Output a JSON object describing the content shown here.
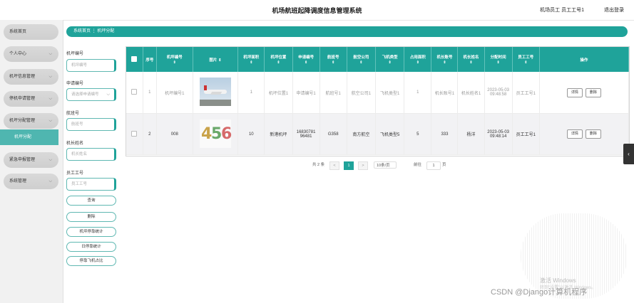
{
  "header": {
    "title": "机场航班起降调度信息管理系统",
    "user": "机场员工 员工工号1",
    "logout": "退出登录"
  },
  "sidebar": {
    "items": [
      {
        "label": "系统首页",
        "chevron": false
      },
      {
        "label": "个人中心",
        "chevron": true
      },
      {
        "label": "机坪信息管理",
        "chevron": true
      },
      {
        "label": "停机申请管理",
        "chevron": true
      },
      {
        "label": "机坪分配管理",
        "chevron": true
      },
      {
        "label": "紧急申报管理",
        "chevron": true
      },
      {
        "label": "系统管理",
        "chevron": true
      }
    ],
    "active_sub": "机坪分配"
  },
  "breadcrumb": {
    "home": "系统首页",
    "sep": "⋮",
    "current": "机坪分配"
  },
  "filters": {
    "apron_no_label": "机坪编号",
    "apron_no_placeholder": "机坪编号",
    "apply_no_label": "申请编号",
    "apply_no_placeholder": "请选择申请编号",
    "flight_no_label": "航班号",
    "flight_no_placeholder": "航班号",
    "captain_label": "机长姓名",
    "captain_placeholder": "机长姓名",
    "staff_no_label": "员工工号",
    "staff_no_placeholder": "员工工号",
    "buttons": [
      "查询",
      "删除",
      "机坪停靠统计",
      "日停靠统计",
      "停靠飞机占比"
    ]
  },
  "table": {
    "headers": [
      "序号",
      "机坪编号",
      "图片",
      "机坪面积",
      "机坪位置",
      "申请编号",
      "航班号",
      "航空公司",
      "飞机类型",
      "占用面积",
      "机长账号",
      "机长姓名",
      "分配时间",
      "员工工号",
      "操作"
    ],
    "sort_marker": "⇕",
    "rows": [
      {
        "index": "1",
        "apron_no": "机坪编号1",
        "image": "plane",
        "area": "1",
        "location": "机坪位置1",
        "apply_no": "申请编号1",
        "flight_no": "航班号1",
        "airline": "航空公司1",
        "plane_type": "飞机类型1",
        "used_area": "1",
        "captain_account": "机长账号1",
        "captain_name": "机长姓名1",
        "time": "2023-05-03 09:48:58",
        "staff_no": "员工工号1"
      },
      {
        "index": "2",
        "apron_no": "008",
        "image": "digits",
        "area": "10",
        "location": "新港机坪",
        "apply_no": "1683078196481",
        "flight_no": "G358",
        "airline": "南方航空",
        "plane_type": "飞机类型5",
        "used_area": "5",
        "captain_account": "333",
        "captain_name": "杨洋",
        "time": "2023-05-03 09:48:14",
        "staff_no": "员工工号1"
      }
    ],
    "detail_label": "详情",
    "delete_label": "删除"
  },
  "pager": {
    "total": "共 2 条",
    "prev": "<",
    "page": "1",
    "next": ">",
    "size": "10条/页",
    "goto_label": "前往",
    "goto_value": "1",
    "page_unit": "页"
  },
  "edge_tab": "‹",
  "watermarks": {
    "windows": "激活 Windows",
    "windows_sub": "转到\"设置\"以激活 Windows。",
    "csdn": "CSDN @Django计算机程序"
  },
  "digits_image_text": "456",
  "colors": {
    "accent": "#1fa39a",
    "accent_light": "#4fb6b0"
  }
}
